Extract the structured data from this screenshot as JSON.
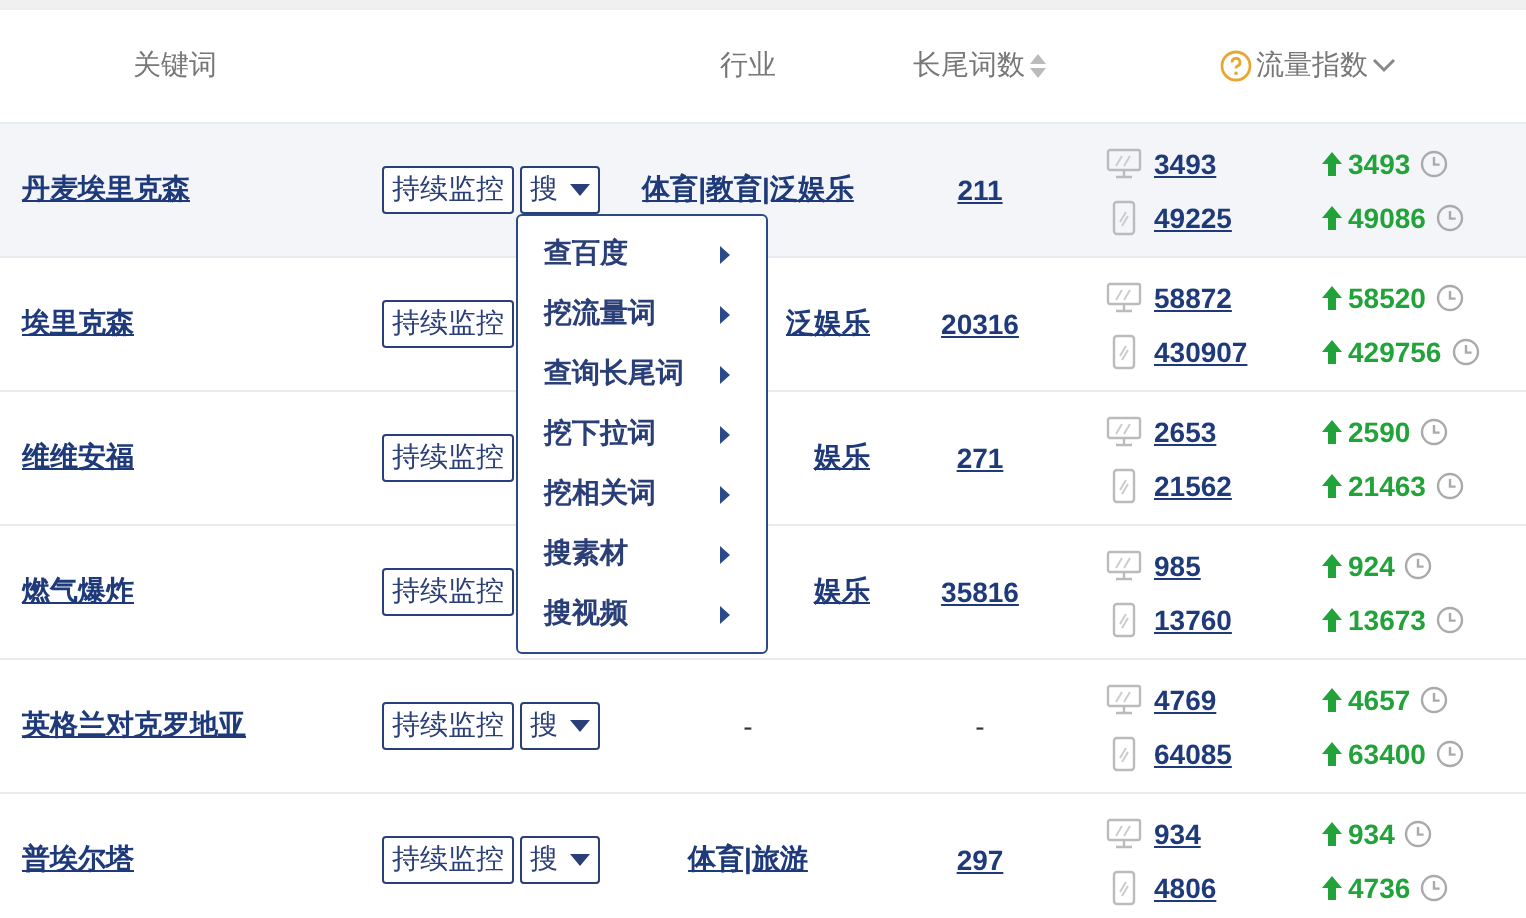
{
  "header": {
    "keyword": "关键词",
    "industry": "行业",
    "long_tail": "长尾词数",
    "traffic": "流量指数"
  },
  "rows": [
    {
      "keyword": "丹麦埃里克森",
      "highlighted": true,
      "monitor": "持续监控",
      "search": "搜",
      "menu_open": true,
      "industry": "体育|教育|泛娱乐",
      "long_tail": "211",
      "pc": "3493",
      "pc_change": "3493",
      "mobile": "49225",
      "mobile_change": "49086"
    },
    {
      "keyword": "埃里克森",
      "highlighted": false,
      "monitor": "持续监控",
      "industry": "泛娱乐",
      "long_tail": "20316",
      "pc": "58872",
      "pc_change": "58520",
      "mobile": "430907",
      "mobile_change": "429756"
    },
    {
      "keyword": "维维安福",
      "highlighted": false,
      "monitor": "持续监控",
      "industry": "娱乐",
      "long_tail": "271",
      "pc": "2653",
      "pc_change": "2590",
      "mobile": "21562",
      "mobile_change": "21463"
    },
    {
      "keyword": "燃气爆炸",
      "highlighted": false,
      "monitor": "持续监控",
      "industry": "娱乐",
      "long_tail": "35816",
      "pc": "985",
      "pc_change": "924",
      "mobile": "13760",
      "mobile_change": "13673"
    },
    {
      "keyword": "英格兰对克罗地亚",
      "highlighted": false,
      "monitor": "持续监控",
      "search": "搜",
      "menu_open": false,
      "industry_none": "-",
      "long_tail_none": "-",
      "pc": "4769",
      "pc_change": "4657",
      "mobile": "64085",
      "mobile_change": "63400"
    },
    {
      "keyword": "普埃尔塔",
      "highlighted": false,
      "monitor": "持续监控",
      "search": "搜",
      "menu_open": false,
      "industry": "体育|旅游",
      "long_tail": "297",
      "pc": "934",
      "pc_change": "934",
      "mobile": "4806",
      "mobile_change": "4736"
    }
  ],
  "search_menu": [
    "查百度",
    "挖流量词",
    "查询长尾词",
    "挖下拉词",
    "挖相关词",
    "搜素材",
    "搜视频"
  ]
}
